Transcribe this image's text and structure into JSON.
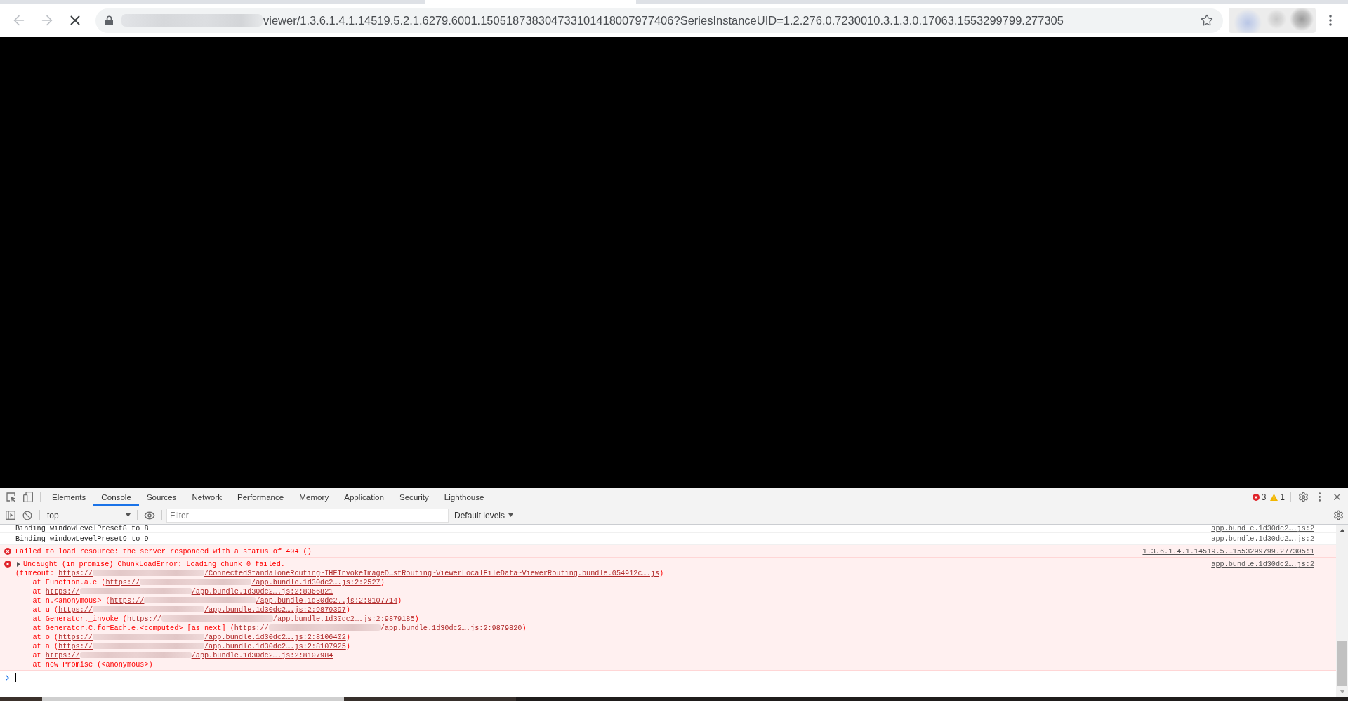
{
  "browser": {
    "nav": [
      {
        "kind": "back",
        "disabled": true
      },
      {
        "kind": "forward",
        "disabled": true
      },
      {
        "kind": "stop",
        "disabled": false
      }
    ],
    "url": "viewer/1.3.6.1.4.1.14519.5.2.1.6279.6001.150518738304733101418007977406?SeriesInstanceUID=1.2.276.0.7230010.3.1.3.0.17063.1553299799.277305"
  },
  "devtools": {
    "tabs": [
      {
        "label": "Elements",
        "selected": false
      },
      {
        "label": "Console",
        "selected": true
      },
      {
        "label": "Sources",
        "selected": false
      },
      {
        "label": "Network",
        "selected": false
      },
      {
        "label": "Performance",
        "selected": false
      },
      {
        "label": "Memory",
        "selected": false
      },
      {
        "label": "Application",
        "selected": false
      },
      {
        "label": "Security",
        "selected": false
      },
      {
        "label": "Lighthouse",
        "selected": false
      }
    ],
    "counters": [
      {
        "kind": "error",
        "count": "3"
      },
      {
        "kind": "warning",
        "count": "1"
      }
    ],
    "toolbar": {
      "context": "top",
      "filter": {
        "placeholder": "Filter"
      },
      "levels": "Default levels"
    },
    "messages": [
      {
        "kind": "log",
        "text": "Binding windowLevelPreset8 to 8",
        "source": "app.bundle.1d30dc2….js:2"
      },
      {
        "kind": "log",
        "text": "Binding windowLevelPreset9 to 9",
        "source": "app.bundle.1d30dc2….js:2"
      },
      {
        "kind": "error",
        "text": "Failed to load resource: the server responded with a status of 404 ()",
        "source": "1.3.6.1.4.1.14519.5.…1553299799.277305:1"
      },
      {
        "kind": "error",
        "expanded": false,
        "text": "Uncaught (in promise) ChunkLoadError: Loading chunk 0 failed.",
        "source": "app.bundle.1d30dc2….js:2",
        "detail": {
          "prefix": "(timeout: ",
          "link_head": "https://",
          "link_tail": "/ConnectedStandaloneRouting~IHEInvokeImageD…stRouting~ViewerLocalFileData~ViewerRouting.bundle.054912c….js",
          "suffix": ")"
        },
        "stack": [
          {
            "prefix": "at Function.a.e (",
            "link_head": "https://",
            "link_tail": "/app.bundle.1d30dc2….js:2:2527",
            "suffix": ")"
          },
          {
            "prefix": "at ",
            "link_head": "https://",
            "link_tail": "/app.bundle.1d30dc2….js:2:8366821"
          },
          {
            "prefix": "at n.<anonymous> (",
            "link_head": "https://",
            "link_tail": "/app.bundle.1d30dc2….js:2:8107714",
            "suffix": ")"
          },
          {
            "prefix": "at u (",
            "link_head": "https://",
            "link_tail": "/app.bundle.1d30dc2….js:2:9879397",
            "suffix": ")"
          },
          {
            "prefix": "at Generator._invoke (",
            "link_head": "https://",
            "link_tail": "/app.bundle.1d30dc2….js:2:9879185",
            "suffix": ")"
          },
          {
            "prefix": "at Generator.C.forEach.e.<computed> [as next] (",
            "link_head": "https://",
            "link_tail": "/app.bundle.1d30dc2….js:2:9879820",
            "suffix": ")"
          },
          {
            "prefix": "at o (",
            "link_head": "https://",
            "link_tail": "/app.bundle.1d30dc2….js:2:8106402",
            "suffix": ")"
          },
          {
            "prefix": "at a (",
            "link_head": "https://",
            "link_tail": "/app.bundle.1d30dc2….js:2:8107925",
            "suffix": ")"
          },
          {
            "prefix": "at ",
            "link_head": "https://",
            "link_tail": "/app.bundle.1d30dc2….js:2:8107984"
          },
          {
            "prefix": "at new Promise (<anonymous>)"
          }
        ]
      }
    ]
  }
}
